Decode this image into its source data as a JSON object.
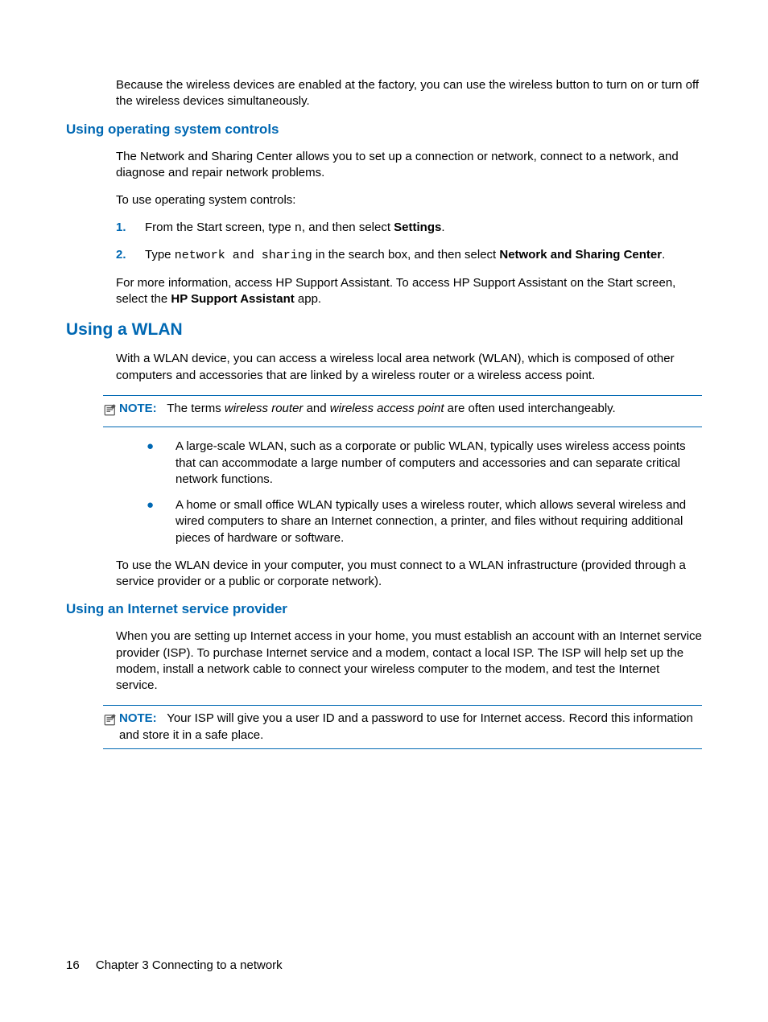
{
  "intro_para": "Because the wireless devices are enabled at the factory, you can use the wireless button to turn on or turn off the wireless devices simultaneously.",
  "h3_os_controls": "Using operating system controls",
  "os_para1": "The Network and Sharing Center allows you to set up a connection or network, connect to a network, and diagnose and repair network problems.",
  "os_para2": "To use operating system controls:",
  "steps": [
    {
      "num": "1.",
      "pre": "From the Start screen, type ",
      "code": "n",
      "mid": ", and then select ",
      "bold": "Settings",
      "post": "."
    },
    {
      "num": "2.",
      "pre": "Type ",
      "code": "network and sharing",
      "mid": " in the search box, and then select ",
      "bold": "Network and Sharing Center",
      "post": "."
    }
  ],
  "os_para3_pre": "For more information, access HP Support Assistant. To access HP Support Assistant on the Start screen, select the ",
  "os_para3_bold": "HP Support Assistant",
  "os_para3_post": " app.",
  "h2_wlan": "Using a WLAN",
  "wlan_para1": "With a WLAN device, you can access a wireless local area network (WLAN), which is composed of other computers and accessories that are linked by a wireless router or a wireless access point.",
  "note1_label": "NOTE:",
  "note1_pre": "The terms ",
  "note1_it1": "wireless router",
  "note1_mid": " and ",
  "note1_it2": "wireless access point",
  "note1_post": " are often used interchangeably.",
  "bullets": [
    "A large-scale WLAN, such as a corporate or public WLAN, typically uses wireless access points that can accommodate a large number of computers and accessories and can separate critical network functions.",
    "A home or small office WLAN typically uses a wireless router, which allows several wireless and wired computers to share an Internet connection, a printer, and files without requiring additional pieces of hardware or software."
  ],
  "wlan_para2": "To use the WLAN device in your computer, you must connect to a WLAN infrastructure (provided through a service provider or a public or corporate network).",
  "h3_isp": "Using an Internet service provider",
  "isp_para1": "When you are setting up Internet access in your home, you must establish an account with an Internet service provider (ISP). To purchase Internet service and a modem, contact a local ISP. The ISP will help set up the modem, install a network cable to connect your wireless computer to the modem, and test the Internet service.",
  "note2_label": "NOTE:",
  "note2_text": "Your ISP will give you a user ID and a password to use for Internet access. Record this information and store it in a safe place.",
  "footer_page": "16",
  "footer_chapter": "Chapter 3   Connecting to a network"
}
